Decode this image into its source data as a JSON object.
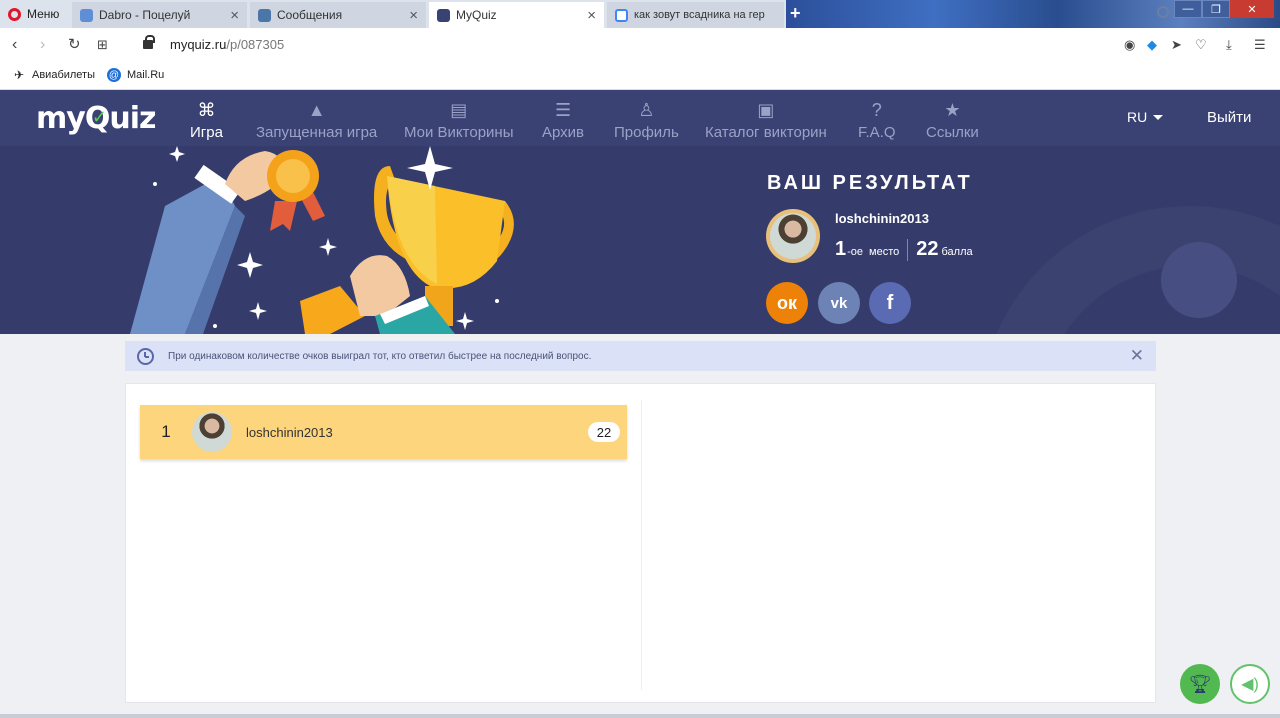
{
  "browser": {
    "menu_label": "Меню",
    "tabs": [
      {
        "title": "Dabro - Поцелуй",
        "icon": "pause-icon",
        "color": "#5e8ed6"
      },
      {
        "title": "Сообщения",
        "icon": "vk-messages-icon",
        "color": "#4a76a8"
      },
      {
        "title": "MyQuiz",
        "icon": "myquiz-icon",
        "color": "#3a4274"
      },
      {
        "title": "как зовут всадника на гер",
        "icon": "google-icon",
        "color": "#4285f4"
      }
    ],
    "url_domain": "myquiz.ru",
    "url_path": "/p/087305",
    "bookmarks": [
      {
        "label": "Авиабилеты",
        "icon": "plane-icon"
      },
      {
        "label": "Mail.Ru",
        "icon": "mailru-icon"
      }
    ]
  },
  "site": {
    "logo_text_a": "my",
    "logo_text_b": "Q",
    "logo_text_c": "uiz",
    "nav": [
      {
        "label": "Игра",
        "icon": "gamepad-icon",
        "active": true
      },
      {
        "label": "Запущенная игра",
        "icon": "rocket-icon"
      },
      {
        "label": "Мои Викторины",
        "icon": "quizzes-icon"
      },
      {
        "label": "Архив",
        "icon": "archive-icon"
      },
      {
        "label": "Профиль",
        "icon": "profile-icon"
      },
      {
        "label": "Каталог викторин",
        "icon": "catalog-icon"
      },
      {
        "label": "F.A.Q",
        "icon": "faq-icon"
      },
      {
        "label": "Ссылки",
        "icon": "bookmark-icon"
      }
    ],
    "language": "RU",
    "logout_label": "Выйти"
  },
  "result": {
    "title": "ВАШ РЕЗУЛЬТАТ",
    "username": "loshchinin2013",
    "place": "1",
    "place_suffix": "-ое",
    "place_word": "место",
    "points": "22",
    "points_word": "балла",
    "share": [
      {
        "name": "odnoklassniki",
        "glyph": "ок"
      },
      {
        "name": "vk",
        "glyph": "vk"
      },
      {
        "name": "facebook",
        "glyph": "f"
      }
    ]
  },
  "notice": {
    "text": "При одинаковом количестве очков выиграл тот, кто ответил быстрее на последний вопрос."
  },
  "leaderboard": [
    {
      "rank": "1",
      "name": "loshchinin2013",
      "score": "22"
    }
  ],
  "colors": {
    "nav_bg": "#3a4274",
    "hero_bg": "#353c6b",
    "row_highlight": "#fdd57d",
    "notice_bg": "#dbe2f7",
    "ok_orange": "#ee8208",
    "vk_blue": "#6d83b5",
    "fb_blue": "#5a6ab3",
    "fab_green": "#52b850"
  }
}
